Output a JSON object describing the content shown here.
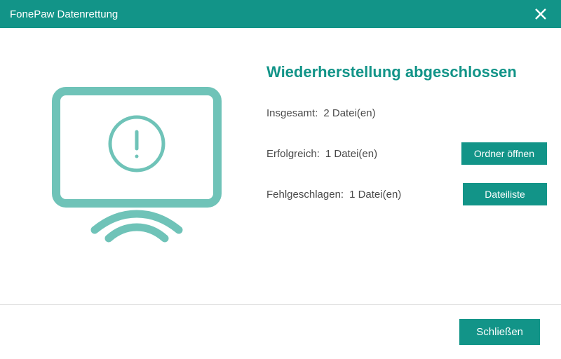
{
  "titlebar": {
    "title": "FonePaw Datenrettung"
  },
  "heading": "Wiederherstellung abgeschlossen",
  "stats": {
    "total_label": "Insgesamt:",
    "total_value": "2 Datei(en)",
    "success_label": "Erfolgreich:",
    "success_value": "1 Datei(en)",
    "failed_label": "Fehlgeschlagen:",
    "failed_value": "1 Datei(en)"
  },
  "buttons": {
    "open_folder": "Ordner öffnen",
    "file_list": "Dateiliste",
    "close": "Schließen"
  },
  "colors": {
    "primary": "#129488",
    "illustration": "#6fc3b8"
  }
}
